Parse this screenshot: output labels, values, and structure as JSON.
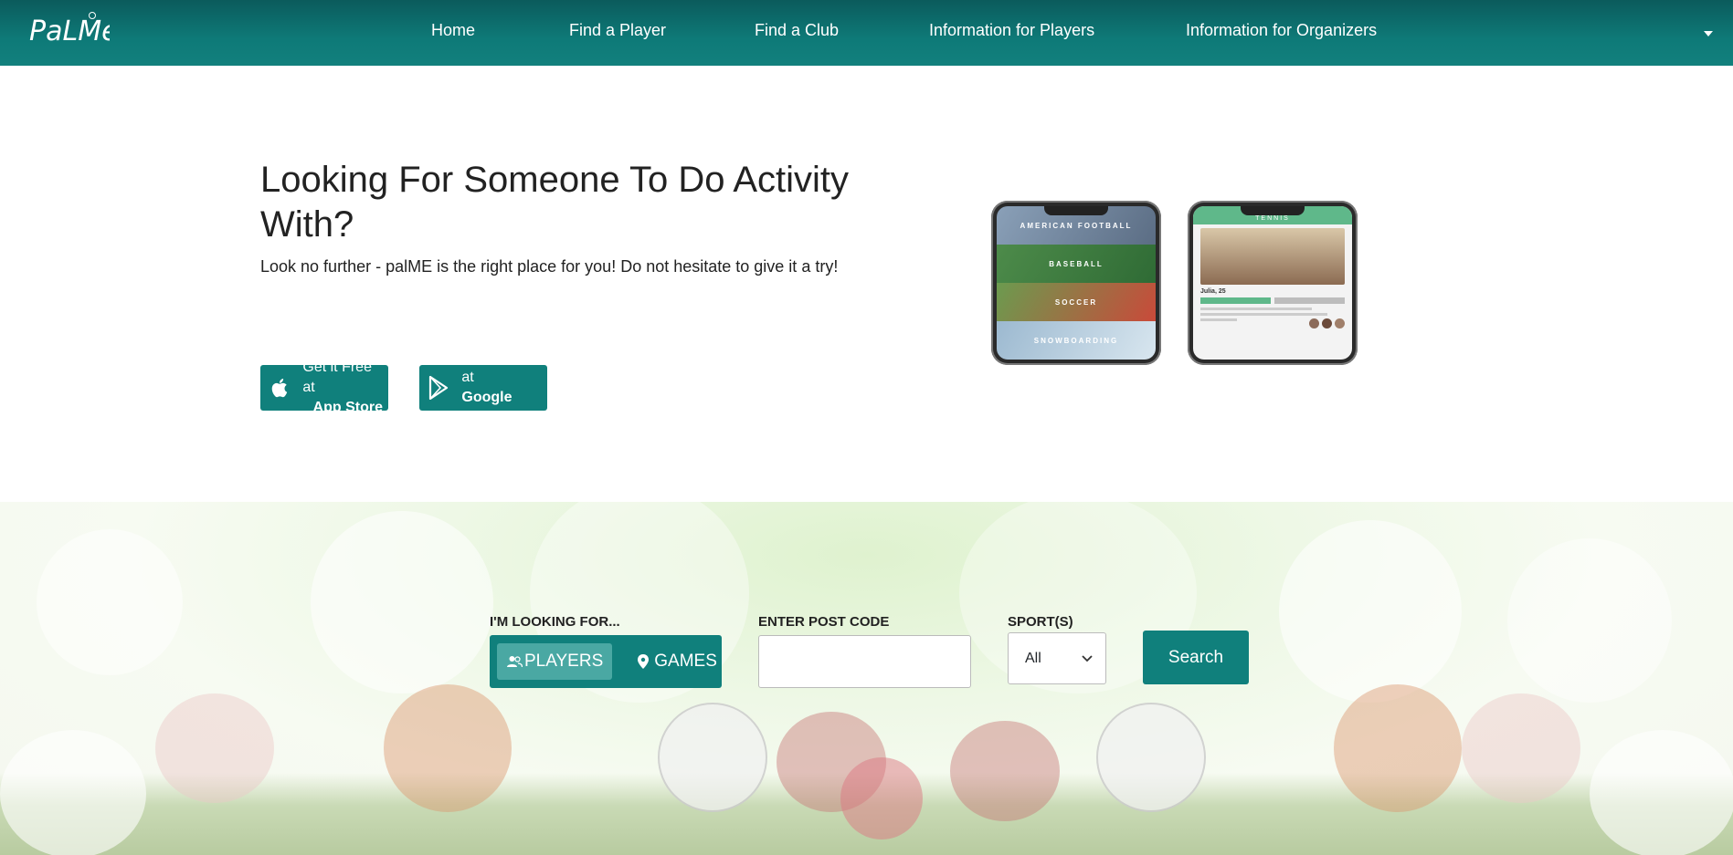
{
  "brand": {
    "logo_text": "PalMe"
  },
  "nav": {
    "items": [
      {
        "label": "Home"
      },
      {
        "label": "Find a Player"
      },
      {
        "label": "Find a Club"
      },
      {
        "label": "Information for Players"
      },
      {
        "label": "Information for Organizers"
      }
    ],
    "caret_icon": "caret-down-icon"
  },
  "hero": {
    "title": "Looking For Someone To Do Activity With?",
    "subtitle": "Look no further - palME is the right place for you! Do not hesitate to give it a try!",
    "app_store": {
      "line1": "Get it Free at",
      "line2": "App Store",
      "icon": "apple-icon"
    },
    "google_play": {
      "line1": "Get it Free at",
      "line2": "Google Play",
      "icon": "google-play-icon"
    }
  },
  "phones": {
    "left": {
      "strips": [
        "AMERICAN FOOTBALL",
        "BASEBALL",
        "SOCCER",
        "SNOWBOARDING"
      ]
    },
    "right": {
      "header": "TENNIS",
      "name": "Julia, 25"
    }
  },
  "search": {
    "looking_for_label": "I'M LOOKING FOR...",
    "players_label": "PLAYERS",
    "games_label": "GAMES",
    "postcode_label": "ENTER POST CODE",
    "postcode_value": "",
    "sports_label": "SPORT(S)",
    "sports_selected": "All",
    "search_button": "Search"
  },
  "colors": {
    "primary": "#10807c",
    "nav_top": "#0b5b5c",
    "active_toggle": "#4aa8a3"
  }
}
